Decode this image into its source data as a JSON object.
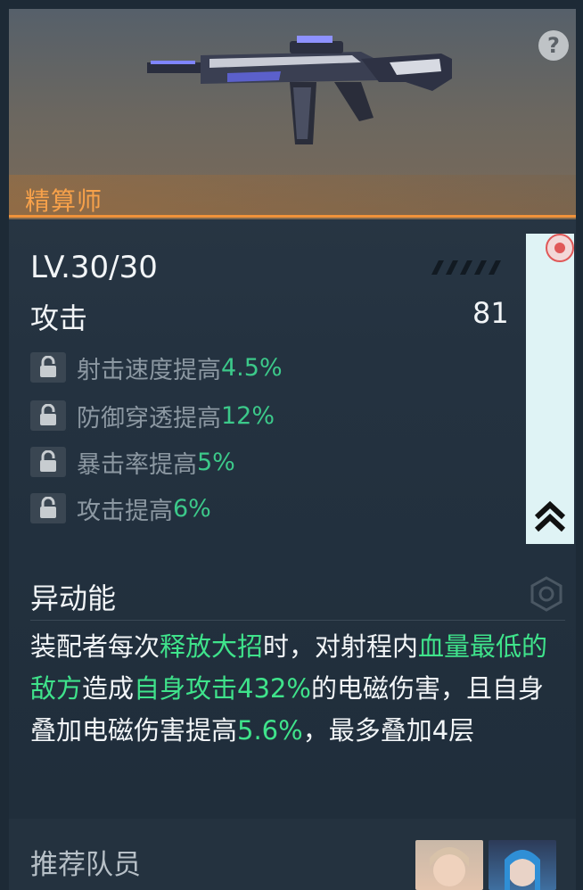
{
  "weapon": {
    "name": "精算师",
    "help_icon": "?"
  },
  "stats": {
    "level": "LV.30/30",
    "attack_label": "攻击",
    "attack_value": "81"
  },
  "bonuses": [
    {
      "label": "射击速度提高",
      "value": "4.5%"
    },
    {
      "label": "防御穿透提高",
      "value": "12%"
    },
    {
      "label": "暴击率提高",
      "value": "5%"
    },
    {
      "label": "攻击提高",
      "value": "6%"
    }
  ],
  "skill": {
    "title": "异动能",
    "desc_parts": [
      {
        "t": "装配者每次",
        "hl": false
      },
      {
        "t": "释放大招",
        "hl": true
      },
      {
        "t": "时，对射程内",
        "hl": false
      },
      {
        "t": "血量最低的敌方",
        "hl": true
      },
      {
        "t": "造成",
        "hl": false
      },
      {
        "t": "自身攻击432%",
        "hl": true
      },
      {
        "t": "的电磁伤害，且自身叠加电磁伤害提高",
        "hl": false
      },
      {
        "t": "5.6%",
        "hl": true
      },
      {
        "t": "，最多叠加4层",
        "hl": false
      }
    ]
  },
  "recommended": {
    "label": "推荐队员"
  },
  "colors": {
    "accent_orange": "#f0923a",
    "highlight_green": "#3fe38b",
    "bonus_green": "#3cc98a"
  }
}
